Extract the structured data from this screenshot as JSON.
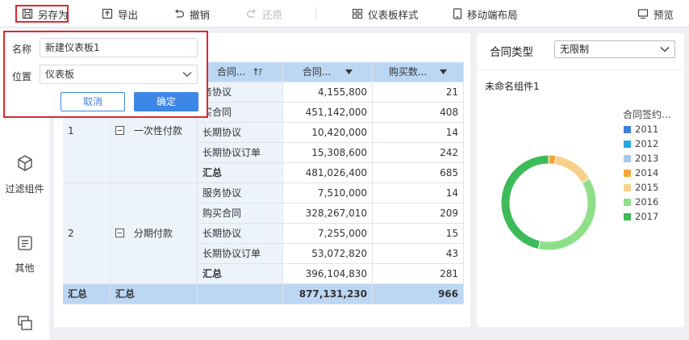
{
  "toolbar": {
    "save_as": "另存为",
    "export": "导出",
    "undo": "撤销",
    "redo": "还原",
    "dashboard_style": "仪表板样式",
    "mobile_layout": "移动端布局",
    "preview": "预览"
  },
  "rail": {
    "filter": "过滤组件",
    "other": "其他"
  },
  "table": {
    "headers": {
      "contract_type": "合同...",
      "contract_amount": "合同...",
      "purchase_count": "购买数..."
    },
    "groups": [
      {
        "index": "1",
        "payment": "一次性付款",
        "rows": [
          {
            "type": "务协议",
            "amount": "4,155,800",
            "count": "21"
          },
          {
            "type": "买合同",
            "amount": "451,142,000",
            "count": "408"
          },
          {
            "type": "长期协议",
            "amount": "10,420,000",
            "count": "14"
          },
          {
            "type": "长期协议订单",
            "amount": "15,308,600",
            "count": "242"
          },
          {
            "type": "汇总",
            "amount": "481,026,400",
            "count": "685"
          }
        ]
      },
      {
        "index": "2",
        "payment": "分期付款",
        "rows": [
          {
            "type": "服务协议",
            "amount": "7,510,000",
            "count": "14"
          },
          {
            "type": "购买合同",
            "amount": "328,267,010",
            "count": "209"
          },
          {
            "type": "长期协议",
            "amount": "7,255,000",
            "count": "15"
          },
          {
            "type": "长期协议订单",
            "amount": "53,072,820",
            "count": "43"
          },
          {
            "type": "汇总",
            "amount": "396,104,830",
            "count": "281"
          }
        ]
      }
    ],
    "grand_total": {
      "c1": "汇总",
      "c2": "汇总",
      "amount": "877,131,230",
      "count": "966"
    }
  },
  "filter": {
    "label": "合同类型",
    "value": "无限制"
  },
  "chart_component": {
    "title": "未命名组件1",
    "legend_title": "合同签约...",
    "legend": [
      {
        "name": "2011",
        "color": "#3d7fd6"
      },
      {
        "name": "2012",
        "color": "#29a8e0"
      },
      {
        "name": "2013",
        "color": "#a9c8ec"
      },
      {
        "name": "2014",
        "color": "#f5a53a"
      },
      {
        "name": "2015",
        "color": "#f8d08a"
      },
      {
        "name": "2016",
        "color": "#8fdf8a"
      },
      {
        "name": "2017",
        "color": "#3dbb5a"
      }
    ]
  },
  "chart_data": {
    "type": "pie",
    "title": "",
    "legend_title": "合同签约...",
    "categories": [
      "2011",
      "2012",
      "2013",
      "2014",
      "2015",
      "2016",
      "2017"
    ],
    "values": [
      0,
      0,
      0,
      2.5,
      14,
      37,
      46.5
    ],
    "donut": true,
    "legend_position": "right"
  },
  "popup": {
    "name_label": "名称",
    "name_value": "新建仪表板1",
    "location_label": "位置",
    "location_value": "仪表板",
    "cancel": "取消",
    "confirm": "确定"
  }
}
